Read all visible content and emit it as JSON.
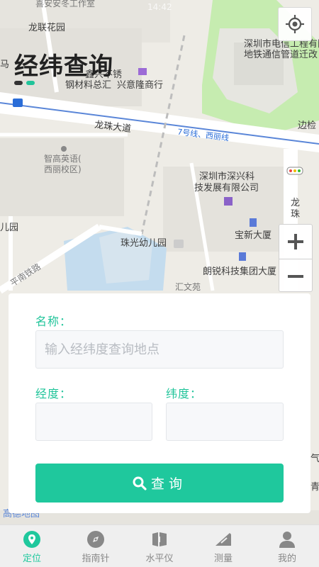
{
  "app": {
    "title": "经纬查询"
  },
  "status_bar": {
    "time": "14:42"
  },
  "map": {
    "labels": {
      "top_store": "喜安安冬工作室",
      "longlian": "龙联花园",
      "ma": "马",
      "xin": "鑫兴不锈",
      "steel": "钢材料总汇",
      "xingyi": "兴意隆商行",
      "telecom1": "深圳市电信工程有限",
      "telecom2": "地铁通信管道迁改",
      "bianjian": "边检",
      "road_longzhu": "龙珠大道",
      "metro": "7号线、西丽线",
      "zhigao1": "智高英语(",
      "zhigao2": "西丽校区)",
      "shenxing1": "深圳市深兴科",
      "shenxing2": "技发展有限公司",
      "long": "龙",
      "zhu": "珠",
      "baoxin": "宝新大厦",
      "kindergarten": "珠光幼儿园",
      "erYuan": "儿园",
      "langrui": "朗锐科技集团大厦",
      "huiwen": "汇文苑",
      "pingnan": "平南铁路",
      "gaode": "高德地图",
      "qi": "气",
      "qing": "青"
    }
  },
  "form": {
    "name_label": "名称：",
    "name_placeholder": "输入经纬度查询地点",
    "lng_label": "经度：",
    "lat_label": "纬度：",
    "lng_value": "",
    "lat_value": "",
    "search_label": "查询"
  },
  "tabs": [
    {
      "label": "定位",
      "icon": "location-icon",
      "active": true
    },
    {
      "label": "指南针",
      "icon": "compass-icon",
      "active": false
    },
    {
      "label": "水平仪",
      "icon": "level-icon",
      "active": false
    },
    {
      "label": "测量",
      "icon": "ruler-icon",
      "active": false
    },
    {
      "label": "我的",
      "icon": "user-icon",
      "active": false
    }
  ],
  "colors": {
    "accent": "#1fc89d",
    "map_green": "#c6ecb0",
    "map_water": "#b7d8f0"
  }
}
